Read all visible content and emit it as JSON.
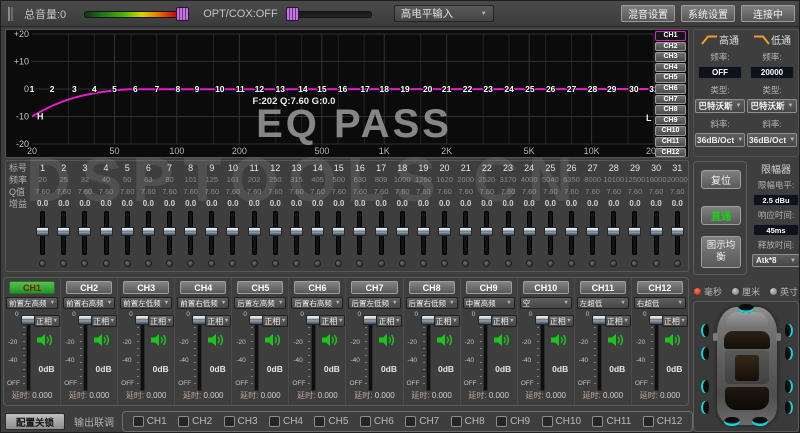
{
  "watermark": "DSPTOOLS CN",
  "top_bar": {
    "volume_label": "总音量:0",
    "opt_label": "OPT/COX:OFF",
    "input_source": "高电平输入",
    "mix_button": "混音设置",
    "system_button": "系统设置",
    "connect_button": "连接中"
  },
  "eq": {
    "watermark": "EQ PASS",
    "cursor_info": "F:202 Q:7.60 G:0.0",
    "left_marker": "H",
    "right_marker": "L",
    "y_ticks": [
      "+20",
      "+10",
      "0",
      "-10",
      "-20"
    ],
    "y_tick_db": [
      20,
      10,
      0,
      -10,
      -20
    ],
    "x_ticks": [
      "20",
      "50",
      "100",
      "200",
      "500",
      "1K",
      "2K",
      "5K",
      "10K",
      "20K"
    ],
    "x_tick_freqs": [
      20,
      50,
      100,
      200,
      500,
      1000,
      2000,
      5000,
      10000,
      20000
    ],
    "channels": [
      "CH1",
      "CH2",
      "CH3",
      "CH4",
      "CH5",
      "CH6",
      "CH7",
      "CH8",
      "CH9",
      "CH10",
      "CH11",
      "CH12"
    ],
    "active_channel_index": 0,
    "row_labels": [
      "标号",
      "频率",
      "Q值",
      "增益"
    ],
    "bands": [
      "1",
      "2",
      "3",
      "4",
      "5",
      "6",
      "7",
      "8",
      "9",
      "10",
      "11",
      "12",
      "13",
      "14",
      "15",
      "16",
      "17",
      "18",
      "19",
      "20",
      "21",
      "22",
      "23",
      "24",
      "25",
      "26",
      "27",
      "28",
      "29",
      "30",
      "31"
    ],
    "freqs": [
      "20",
      "25",
      "32",
      "40",
      "50",
      "63",
      "80",
      "101",
      "125",
      "161",
      "202",
      "250",
      "315",
      "405",
      "500",
      "630",
      "809",
      "1000",
      "1260",
      "1620",
      "2000",
      "2520",
      "3170",
      "4000",
      "5040",
      "6350",
      "8000",
      "10100",
      "12500",
      "16000",
      "20000"
    ],
    "freq_values": [
      20,
      25,
      32,
      40,
      50,
      63,
      80,
      101,
      125,
      161,
      202,
      250,
      315,
      405,
      500,
      630,
      809,
      1000,
      1260,
      1620,
      2000,
      2520,
      3170,
      4000,
      5040,
      6350,
      8000,
      10100,
      12500,
      16000,
      20000
    ],
    "q_values": [
      "7.60",
      "7.60",
      "7.60",
      "7.60",
      "7.60",
      "7.60",
      "7.60",
      "7.60",
      "7.60",
      "7.60",
      "7.60",
      "7.60",
      "7.60",
      "7.60",
      "7.60",
      "7.60",
      "7.60",
      "7.60",
      "7.60",
      "7.60",
      "7.60",
      "7.60",
      "7.60",
      "7.60",
      "7.60",
      "7.60",
      "7.60",
      "7.60",
      "7.60",
      "7.60",
      "7.60"
    ],
    "gains": [
      "0.0",
      "0.0",
      "0.0",
      "0.0",
      "0.0",
      "0.0",
      "0.0",
      "0.0",
      "0.0",
      "0.0",
      "0.0",
      "0.0",
      "0.0",
      "0.0",
      "0.0",
      "0.0",
      "0.0",
      "0.0",
      "0.0",
      "0.0",
      "0.0",
      "0.0",
      "0.0",
      "0.0",
      "0.0",
      "0.0",
      "0.0",
      "0.0",
      "0.0",
      "0.0",
      "0.0"
    ]
  },
  "controls": {
    "reset": "复位",
    "bypass": "直通",
    "graphic_eq": "图示均衡"
  },
  "filters": {
    "highpass": {
      "title": "高通",
      "freq_label": "频率:",
      "freq": "OFF",
      "type_label": "类型:",
      "type": "巴特沃斯",
      "slope_label": "斜率:",
      "slope": "36dB/Oct"
    },
    "lowpass": {
      "title": "低通",
      "freq_label": "频率:",
      "freq": "20000",
      "type_label": "类型:",
      "type": "巴特沃斯",
      "slope_label": "斜率:",
      "slope": "36dB/Oct"
    }
  },
  "limiter": {
    "title": "限幅器",
    "level_label": "限幅电平:",
    "level": "2.5 dBu",
    "attack_label": "响应时间:",
    "attack": "45ms",
    "release_label": "释放时间:",
    "release": "Atk*8"
  },
  "strips": {
    "scale_ticks": [
      "0",
      "-20",
      "-40",
      "OFF"
    ],
    "delay_label": "延时:",
    "channels": [
      {
        "name": "CH1",
        "output": "前置左高频",
        "phase": "正相",
        "gain": "0dB",
        "delay": "0.000",
        "active": true
      },
      {
        "name": "CH2",
        "output": "前置右高频",
        "phase": "正相",
        "gain": "0dB",
        "delay": "0.000",
        "active": false
      },
      {
        "name": "CH3",
        "output": "前置左低频",
        "phase": "正相",
        "gain": "0dB",
        "delay": "0.000",
        "active": false
      },
      {
        "name": "CH4",
        "output": "前置右低频",
        "phase": "正相",
        "gain": "0dB",
        "delay": "0.000",
        "active": false
      },
      {
        "name": "CH5",
        "output": "后置左高频",
        "phase": "正相",
        "gain": "0dB",
        "delay": "0.000",
        "active": false
      },
      {
        "name": "CH6",
        "output": "后置右高频",
        "phase": "正相",
        "gain": "0dB",
        "delay": "0.000",
        "active": false
      },
      {
        "name": "CH7",
        "output": "后置左低频",
        "phase": "正相",
        "gain": "0dB",
        "delay": "0.000",
        "active": false
      },
      {
        "name": "CH8",
        "output": "后置右低频",
        "phase": "正相",
        "gain": "0dB",
        "delay": "0.000",
        "active": false
      },
      {
        "name": "CH9",
        "output": "中置高频",
        "phase": "正相",
        "gain": "0dB",
        "delay": "0.000",
        "active": false
      },
      {
        "name": "CH10",
        "output": "空",
        "phase": "正相",
        "gain": "0dB",
        "delay": "0.000",
        "active": false
      },
      {
        "name": "CH11",
        "output": "左超低",
        "phase": "正相",
        "gain": "0dB",
        "delay": "0.000",
        "active": false
      },
      {
        "name": "CH12",
        "output": "右超低",
        "phase": "正相",
        "gain": "0dB",
        "delay": "0.000",
        "active": false
      }
    ]
  },
  "delay_units": {
    "options": [
      {
        "label": "毫秒",
        "selected": true
      },
      {
        "label": "厘米",
        "selected": false
      },
      {
        "label": "英寸",
        "selected": false
      }
    ]
  },
  "bottom_bar": {
    "lock_button": "配置关锁",
    "link_label": "输出联调",
    "checkboxes": [
      "CH1",
      "CH2",
      "CH3",
      "CH4",
      "CH5",
      "CH6",
      "CH7",
      "CH8",
      "CH9",
      "CH10",
      "CH11",
      "CH12"
    ]
  },
  "colors": {
    "curve": "#e51ccd",
    "accent_orange": "#f49b2a",
    "active_green": "#2fa82a",
    "bypass_green": "#18d018",
    "speaker_cyan": "#12d6d6",
    "selected_red": "#c41508"
  }
}
